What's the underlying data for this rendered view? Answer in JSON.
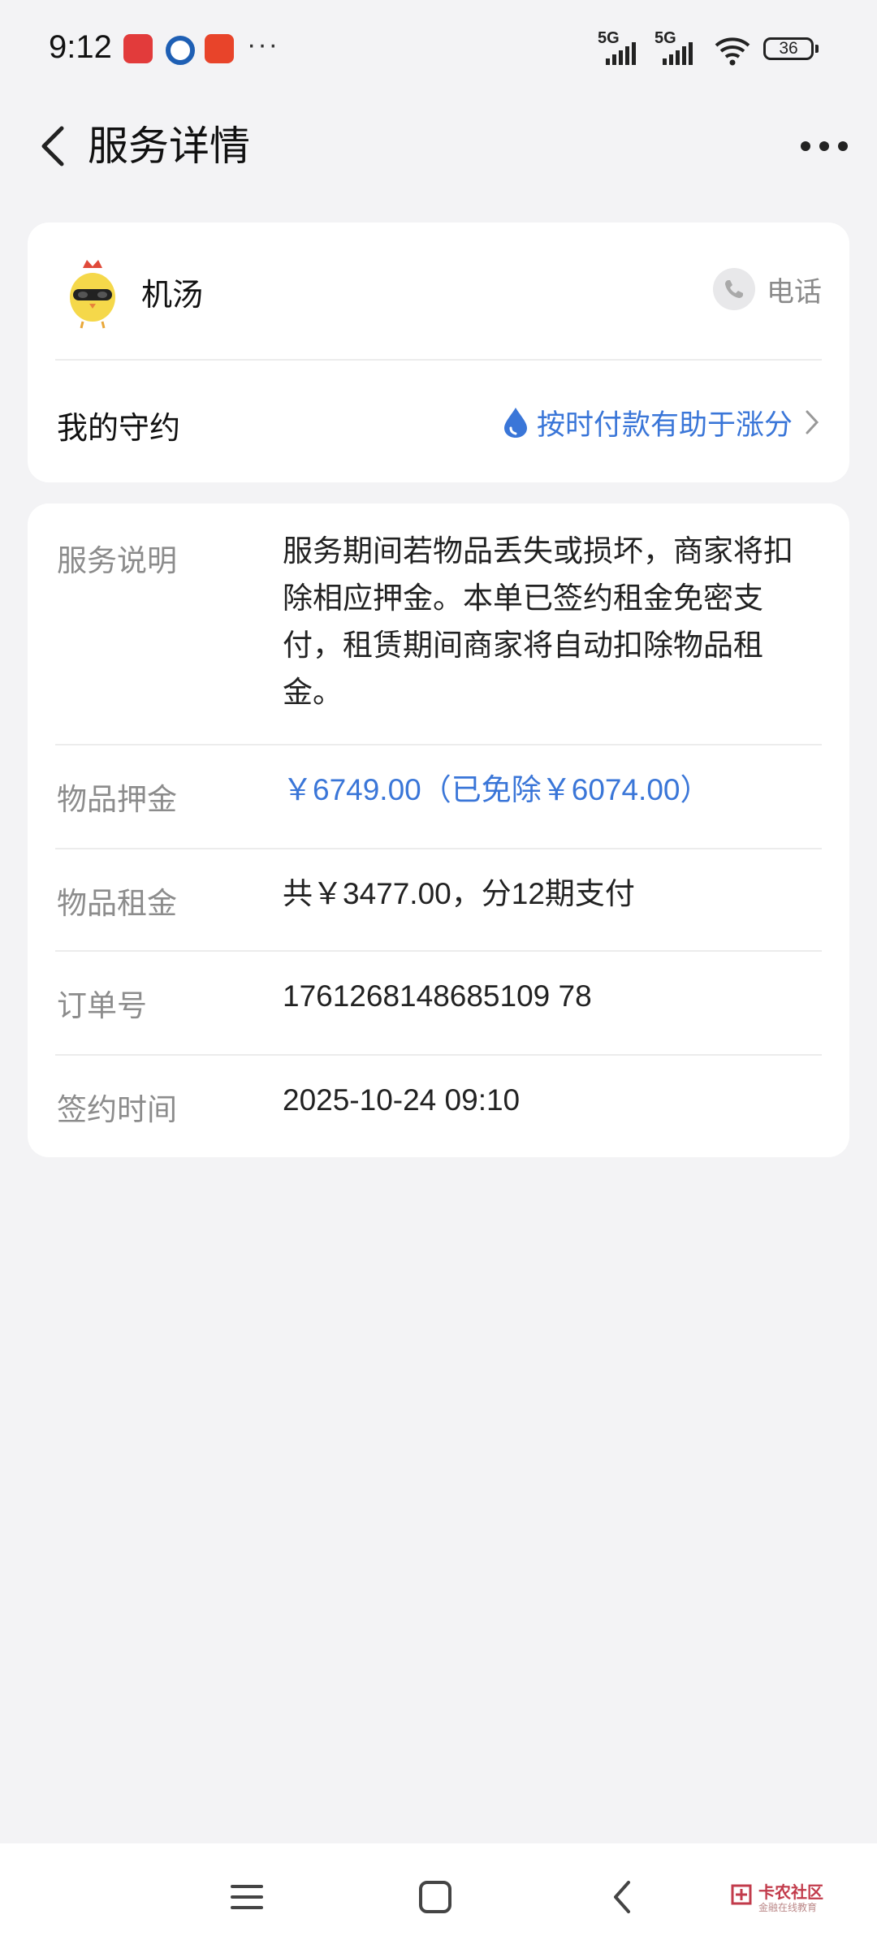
{
  "status_bar": {
    "time": "9:12",
    "more_dots": "···",
    "signal1_label": "5G",
    "signal2_label": "5G",
    "battery": "36"
  },
  "header": {
    "title": "服务详情"
  },
  "merchant": {
    "name": "机汤",
    "phone_label": "电话"
  },
  "promise": {
    "label": "我的守约",
    "link_text": "按时付款有助于涨分"
  },
  "details": {
    "service_desc_label": "服务说明",
    "service_desc_value": "服务期间若物品丢失或损坏，商家将扣除相应押金。本单已签约租金免密支付，租赁期间商家将自动扣除物品租金。",
    "deposit_label": "物品押金",
    "deposit_value": "￥6749.00（已免除￥6074.00）",
    "rent_label": "物品租金",
    "rent_value": "共￥3477.00，分12期支付",
    "order_label": "订单号",
    "order_value": "1761268148685109 78",
    "sign_time_label": "签约时间",
    "sign_time_value": "2025-10-24 09:10"
  },
  "watermark": {
    "title": "卡农社区",
    "subtitle": "金融在线教育"
  },
  "colors": {
    "accent": "#3a76d8",
    "background": "#f3f3f5",
    "card": "#ffffff"
  }
}
